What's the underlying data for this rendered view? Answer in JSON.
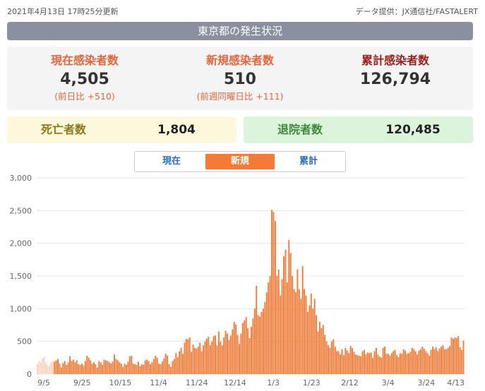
{
  "header": {
    "updated": "2021年4月13日 17時25分更新",
    "source": "データ提供：JX通信社/FASTALERT"
  },
  "title": "東京都の発生状況",
  "stats": [
    {
      "label": "現在感染者数",
      "value": "4,505",
      "sub": "(前日比 +510)"
    },
    {
      "label": "新規感染者数",
      "value": "510",
      "sub": "(前週同曜日比 +111)"
    },
    {
      "label": "累計感染者数",
      "value": "126,794",
      "sub": ""
    }
  ],
  "deaths": {
    "label": "死亡者数",
    "value": "1,804"
  },
  "recovered": {
    "label": "退院者数",
    "value": "120,485"
  },
  "tabs": [
    "現在",
    "新規",
    "累計"
  ],
  "active_tab": "新規",
  "colors": {
    "bar": "#f47a36",
    "bar_faded": "#fbd3bd",
    "accent_orange": "#e8643c",
    "dark_red": "#9e1c1c"
  },
  "chart_data": {
    "type": "bar",
    "x_ticks": [
      "9/5",
      "9/25",
      "10/15",
      "11/4",
      "11/24",
      "12/14",
      "1/3",
      "1/23",
      "2/12",
      "3/4",
      "3/24",
      "4/13"
    ],
    "y_ticks": [
      "0",
      "500",
      "1,000",
      "1,500",
      "2,000",
      "2,500",
      "3,000"
    ],
    "ylim": [
      0,
      3000
    ],
    "grid": true,
    "values": [
      150,
      200,
      180,
      240,
      260,
      170,
      140,
      120,
      180,
      200,
      190,
      210,
      230,
      160,
      100,
      170,
      200,
      140,
      180,
      270,
      200,
      220,
      180,
      210,
      150,
      140,
      160,
      130,
      200,
      280,
      250,
      210,
      160,
      180,
      150,
      100,
      200,
      180,
      140,
      220,
      210,
      200,
      180,
      160,
      190,
      300,
      230,
      210,
      180,
      160,
      110,
      160,
      140,
      190,
      270,
      280,
      160,
      150,
      140,
      190,
      120,
      150,
      140,
      210,
      220,
      200,
      150,
      180,
      230,
      280,
      250,
      160,
      150,
      190,
      240,
      310,
      280,
      150,
      110,
      200,
      230,
      320,
      260,
      350,
      400,
      310,
      480,
      540,
      530,
      560,
      340,
      450,
      400,
      390,
      420,
      480,
      350,
      440,
      500,
      540,
      570,
      440,
      500,
      580,
      590,
      440,
      650,
      500,
      440,
      560,
      660,
      620,
      520,
      590,
      680,
      800,
      760,
      600,
      460,
      620,
      780,
      820,
      870,
      700,
      550,
      720,
      850,
      1000,
      1350,
      900,
      880,
      950,
      1000,
      1100,
      1250,
      1400,
      1500,
      2510,
      2480,
      2340,
      1500,
      1600,
      1200,
      1450,
      1800,
      1900,
      1400,
      2050,
      1850,
      1500,
      1300,
      1250,
      1600,
      1300,
      1150,
      1650,
      1300,
      1200,
      950,
      1050,
      1230,
      1000,
      1150,
      900,
      650,
      800,
      700,
      750,
      600,
      500,
      440,
      400,
      500,
      530,
      420,
      350,
      350,
      300,
      380,
      290,
      400,
      360,
      320,
      430,
      400,
      340,
      300,
      290,
      280,
      270,
      350,
      370,
      300,
      330,
      320,
      330,
      250,
      350,
      400,
      300,
      270,
      250,
      400,
      420,
      310,
      310,
      280,
      320,
      350,
      370,
      290,
      260,
      320,
      310,
      380,
      360,
      310,
      320,
      340,
      400,
      380,
      350,
      300,
      360,
      380,
      420,
      390,
      350,
      320,
      280,
      370,
      420,
      380,
      410,
      350,
      390,
      420,
      440,
      380,
      380,
      400,
      430,
      560,
      540,
      560,
      550,
      580,
      410,
      370,
      510
    ]
  }
}
